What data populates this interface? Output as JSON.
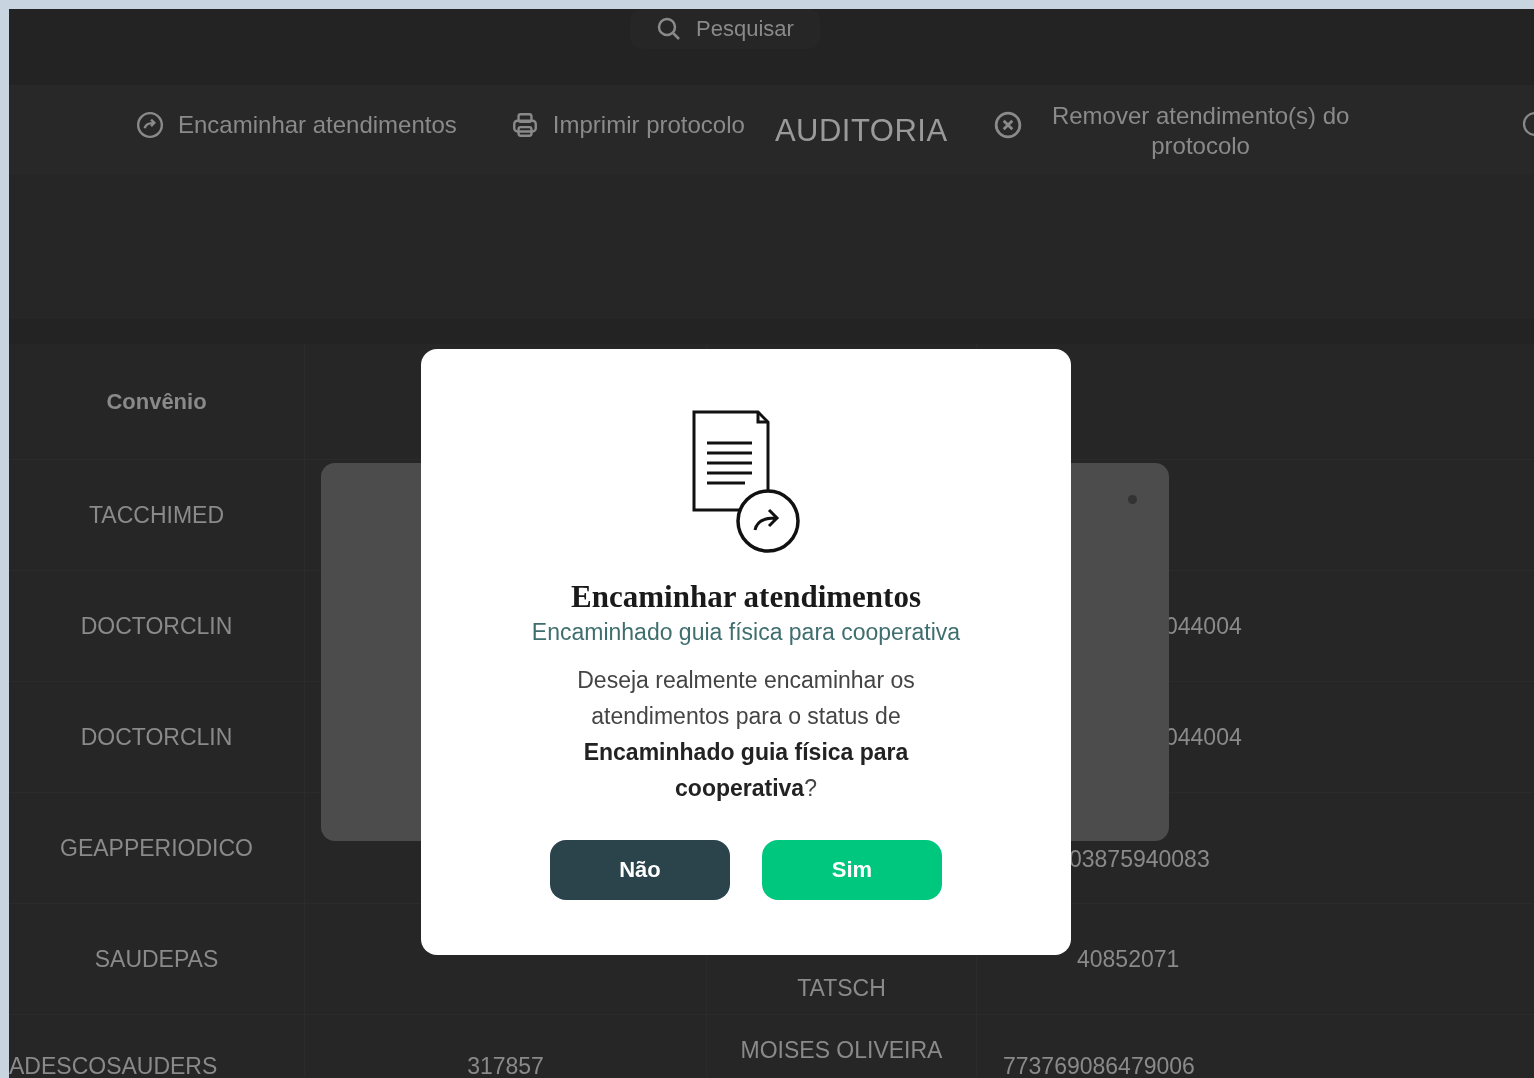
{
  "search": {
    "placeholder": "Pesquisar"
  },
  "toolbar": [
    {
      "kind": "forward",
      "label": "Encaminhar atendimentos"
    },
    {
      "kind": "print",
      "label": "Imprimir protocolo"
    },
    {
      "kind": "heading",
      "label": "AUDITORIA"
    },
    {
      "kind": "remove",
      "label": "Remover atendimento(s) do protocolo"
    },
    {
      "kind": "edge"
    }
  ],
  "table": {
    "columns": [
      "Convênio"
    ],
    "rows": [
      {
        "column_1": "TACCHIMED"
      },
      {
        "column_1": "DOCTORCLIN",
        "column_4": "044004"
      },
      {
        "column_1": "DOCTORCLIN",
        "column_4": "044004"
      },
      {
        "column_1": "GEAPPERIODICO",
        "column_4": "03875940083"
      },
      {
        "column_1": "SAUDEPAS",
        "column_3": "TATSCH",
        "column_4": "40852071"
      },
      {
        "column_1": "ADESCOSAUDERS",
        "column_2": "317857",
        "column_3": "MOISES OLIVEIRA",
        "column_4": "773769086479006"
      }
    ]
  },
  "modal": {
    "title": "Encaminhar atendimentos",
    "subtitle": "Encaminhado guia física para cooperativa",
    "message": "Deseja realmente encaminhar os atendimentos para o status de **Encaminhado guia física para cooperativa**?",
    "buttons": [
      {
        "kind": "secondary",
        "label": "Não"
      },
      {
        "kind": "primary",
        "label": "Sim"
      }
    ]
  }
}
